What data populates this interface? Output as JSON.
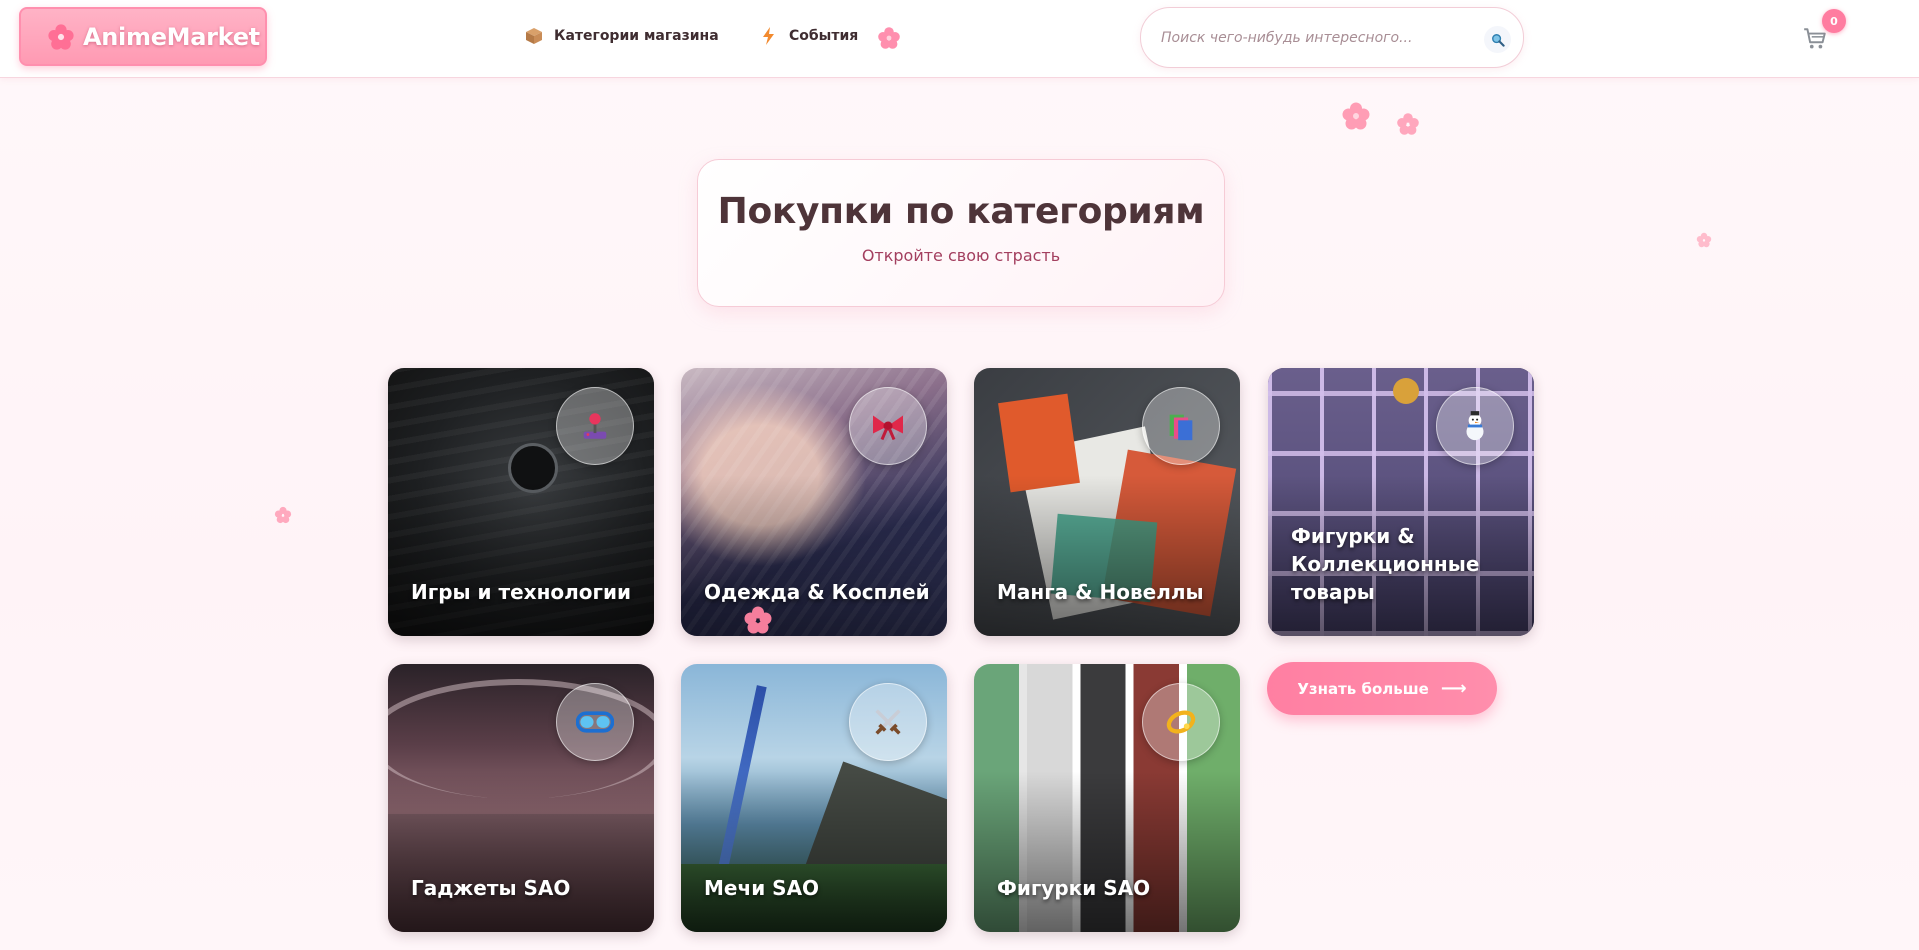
{
  "header": {
    "logo_text": "AnimeMarket",
    "nav": [
      {
        "label": "Категории магазина",
        "icon": "box-icon"
      },
      {
        "label": "События",
        "icon": "lightning-icon"
      }
    ],
    "search_placeholder": "Поиск чего-нибудь интересного...",
    "cart_count": "0"
  },
  "hero": {
    "title": "Покупки по категориям",
    "subtitle": "Откройте свою страсть"
  },
  "categories": [
    {
      "label": "Игры и технологии",
      "icon": "joystick-icon"
    },
    {
      "label": "Одежда & Косплей",
      "icon": "ribbon-icon"
    },
    {
      "label": "Манга & Новеллы",
      "icon": "books-icon"
    },
    {
      "label": "Фигурки & Коллекционные товары",
      "icon": "snowman-icon"
    },
    {
      "label": "Гаджеты SAO",
      "icon": "goggles-icon"
    },
    {
      "label": "Мечи SAO",
      "icon": "crossed-swords-icon"
    },
    {
      "label": "Фигурки SAO",
      "icon": "halo-icon"
    }
  ],
  "more_button": {
    "label": "Узнать больше",
    "arrow": "⟶"
  },
  "colors": {
    "accent": "#ff7ca0",
    "heading": "#4e3439",
    "subtitle": "#a33f5f"
  }
}
